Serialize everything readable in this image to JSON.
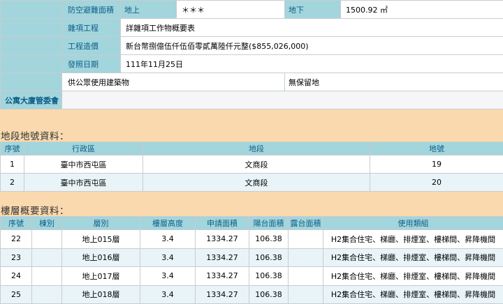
{
  "top": {
    "rows": [
      {
        "label": "防空避難面積",
        "above_label": "地上",
        "above_value": "＊＊＊",
        "below_label": "地下",
        "below_value": "1500.92 ㎡"
      },
      {
        "label": "雜項工程",
        "value": "詳雜項工作物概要表"
      },
      {
        "label": "工程造價",
        "value": "新台幣捌億伍仟伍佰零貳萬陸仟元整($855,026,000)"
      },
      {
        "label": "發照日期",
        "value": "111年11月25日"
      }
    ],
    "public_use": "供公眾使用建築物",
    "reserved": "無保留地",
    "committee_label": "公寓大廈管委會",
    "committee_value": ""
  },
  "land_section": {
    "title": "地段地號資料：",
    "headers": [
      "序號",
      "行政區",
      "地段",
      "地號"
    ],
    "rows": [
      [
        "1",
        "臺中市西屯區",
        "文商段",
        "19"
      ],
      [
        "2",
        "臺中市西屯區",
        "文商段",
        "20"
      ]
    ]
  },
  "floor_section": {
    "title": "樓層概要資料：",
    "headers": [
      "序號",
      "棟別",
      "層別",
      "樓層高度",
      "申請面積",
      "陽台面積",
      "露台面積",
      "使用類組"
    ],
    "rows": [
      [
        "22",
        "",
        "地上015層",
        "3.4",
        "1334.27",
        "106.38",
        "",
        "H2集合住宅、梯廳、排煙室、樓梯間、昇降機間"
      ],
      [
        "23",
        "",
        "地上016層",
        "3.4",
        "1334.27",
        "106.38",
        "",
        "H2集合住宅、梯廳、排煙室、樓梯間、昇降機間"
      ],
      [
        "24",
        "",
        "地上017層",
        "3.4",
        "1334.27",
        "106.38",
        "",
        "H2集合住宅、梯廳、排煙室、樓梯間、昇降機間"
      ],
      [
        "25",
        "",
        "地上018層",
        "3.4",
        "1334.27",
        "106.38",
        "",
        "H2集合住宅、梯廳、排煙室、樓梯間、昇降機間"
      ]
    ]
  }
}
